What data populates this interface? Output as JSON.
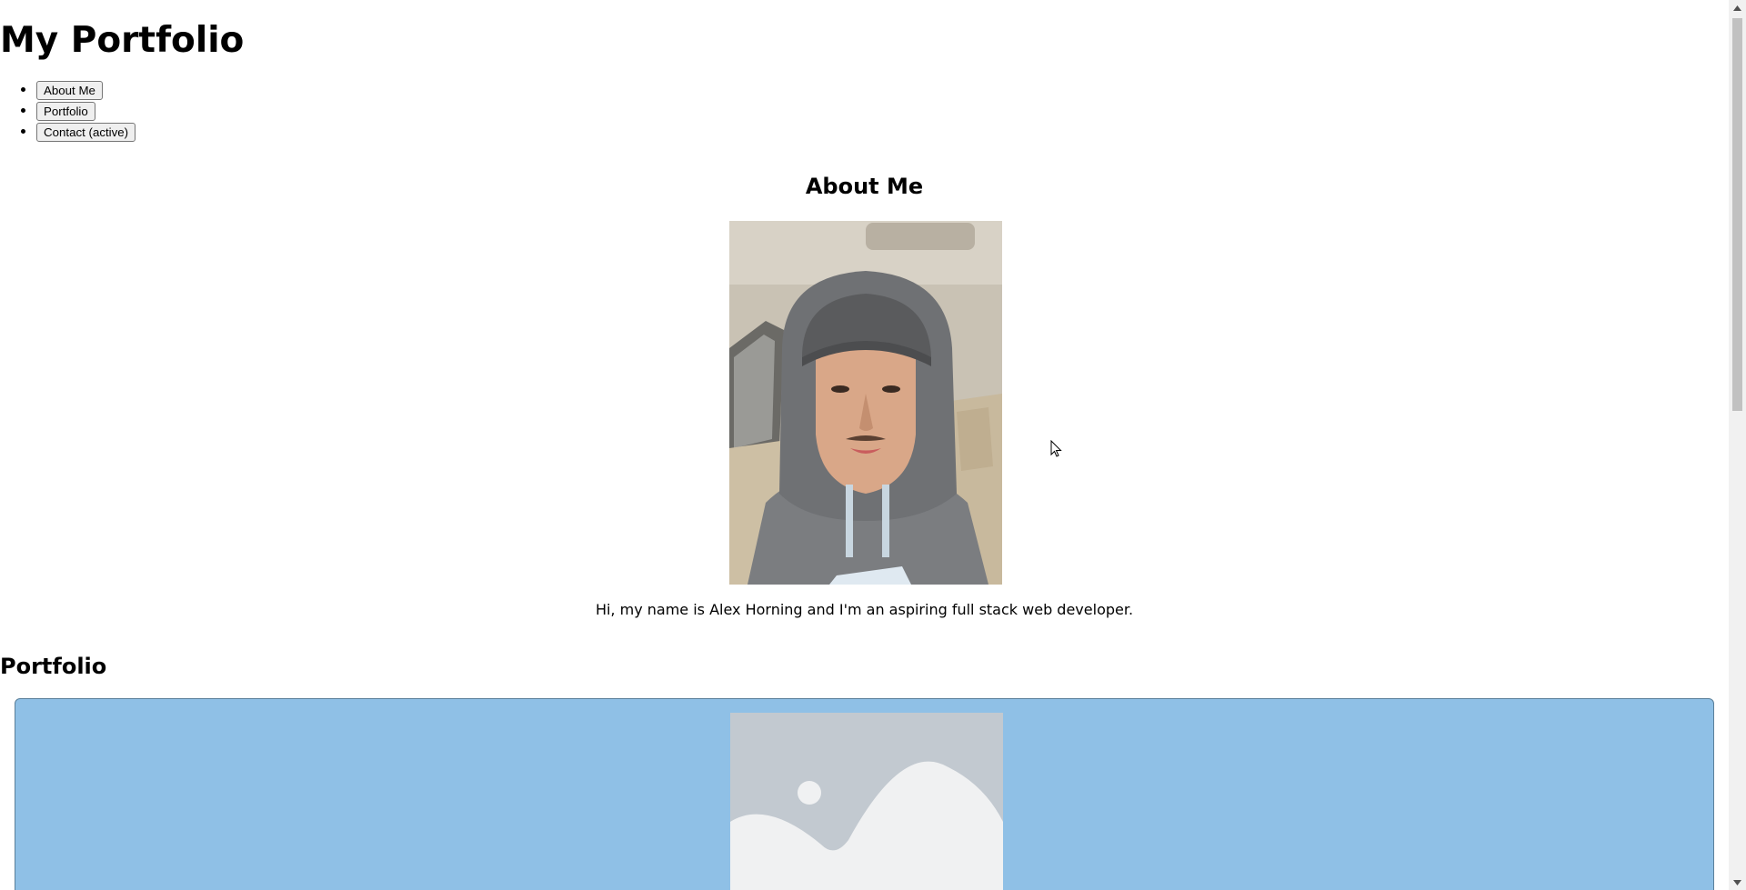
{
  "header": {
    "title": "My Portfolio"
  },
  "nav": {
    "items": [
      {
        "label": "About Me"
      },
      {
        "label": "Portfolio"
      },
      {
        "label": "Contact (active)"
      }
    ]
  },
  "about": {
    "heading": "About Me",
    "bio": "Hi, my name is Alex Horning and I'm an aspiring full stack web developer."
  },
  "portfolio": {
    "heading": "Portfolio"
  },
  "colors": {
    "card_background": "#8fc0e6",
    "placeholder_bg": "#c2c9d0",
    "placeholder_fg": "#f0f1f2"
  },
  "icons": {
    "profile": "profile-photo",
    "placeholder": "image-placeholder-icon",
    "cursor": "mouse-cursor-icon"
  }
}
